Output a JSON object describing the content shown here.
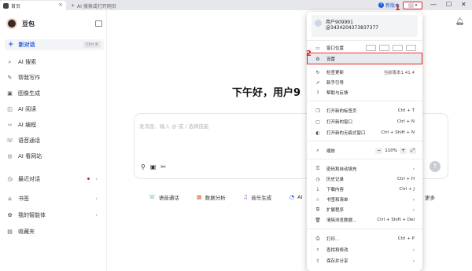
{
  "titlebar": {
    "active_tab": "首页",
    "new_tab": "AI 搜索或打开网页",
    "new_version": "新版本",
    "icons": [
      "home-icon",
      "close-icon",
      "plus-icon",
      "minimize-icon",
      "maximize-icon",
      "window-close-icon"
    ]
  },
  "annotations": {
    "step1": "1",
    "step2": "2",
    "highlight_color": "#e02424"
  },
  "sidebar": {
    "brand": "豆包",
    "new_chat": "新对话",
    "new_chat_shortcut": "Ctrl K",
    "items": [
      {
        "label": "AI 搜索",
        "icon": "search-icon"
      },
      {
        "label": "帮我写作",
        "icon": "pen-icon"
      },
      {
        "label": "图像生成",
        "icon": "image-icon"
      },
      {
        "label": "AI 阅读",
        "icon": "reading-icon"
      },
      {
        "label": "AI 编程",
        "icon": "code-icon"
      },
      {
        "label": "语音通话",
        "icon": "phone-icon"
      },
      {
        "label": "AI 看网站",
        "icon": "web-icon"
      }
    ],
    "sections": [
      {
        "label": "最近对话",
        "icon": "clock-icon"
      },
      {
        "label": "书签",
        "icon": "bookmark-icon"
      },
      {
        "label": "我的智能体",
        "icon": "agent-icon"
      },
      {
        "label": "收藏夹",
        "icon": "favorites-icon"
      }
    ]
  },
  "main": {
    "greeting": "下午好，用户9",
    "composer_placeholder": "发消息、输入 @ 或 / 选择技能",
    "chips": [
      {
        "label": "语音通话",
        "icon": "phone-icon"
      },
      {
        "label": "数据分析",
        "icon": "data-icon"
      },
      {
        "label": "音乐生成",
        "icon": "music-icon"
      },
      {
        "label": "AI",
        "icon": "ai-icon"
      },
      {
        "label": "更多",
        "icon": "more-icon"
      }
    ]
  },
  "menu": {
    "user_name": "用户909991",
    "user_id": "@3434204373837377",
    "window_position": "窗口位置",
    "settings": "设置",
    "check_update": "检查更新",
    "current_version": "当前版本1.41.4",
    "guide": "新手引导",
    "help": "帮助与反馈",
    "new_tab": "打开新的标签页",
    "new_tab_sc": "Ctrl + T",
    "new_window": "打开新的窗口",
    "new_window_sc": "Ctrl + N",
    "incognito": "打开新的无痕式窗口",
    "incognito_sc": "Ctrl + Shift + N",
    "zoom": "缩放",
    "zoom_value": "110%",
    "passwords": "密码和自动填充",
    "history": "历史记录",
    "history_sc": "Ctrl + H",
    "downloads": "下载内容",
    "downloads_sc": "Ctrl + J",
    "bookmarks": "书签和清单",
    "extensions": "扩展程序",
    "clear_data": "清除浏览数据...",
    "clear_data_sc": "Ctrl + Shift + Del",
    "print": "打印...",
    "print_sc": "Ctrl + P",
    "find": "查找和修改",
    "save_share": "保存并分享"
  }
}
